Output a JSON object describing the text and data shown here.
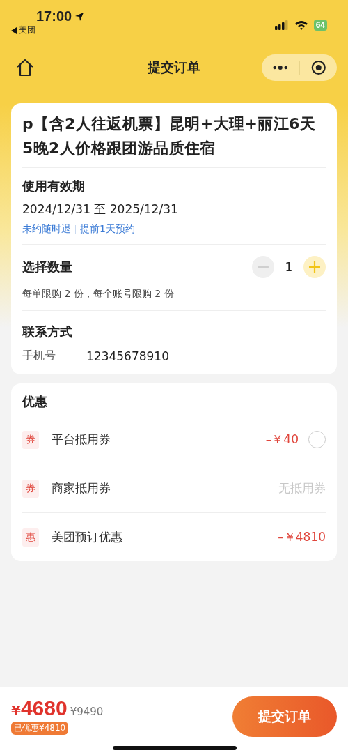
{
  "status_bar": {
    "time": "17:00",
    "back_app": "美团",
    "battery": "64"
  },
  "nav": {
    "title": "提交订单"
  },
  "product": {
    "title": "p【含2人往返机票】昆明+大理+丽江6天5晚2人价格跟团游品质住宿"
  },
  "validity": {
    "label": "使用有效期",
    "dates": "2024/12/31 至 2025/12/31",
    "tags": [
      "未约随时退",
      "提前1天预约"
    ]
  },
  "quantity": {
    "label": "选择数量",
    "value": "1",
    "minus_disabled": true,
    "plus_disabled": false,
    "limit": "每单限购 2 份，每个账号限购 2 份"
  },
  "contact": {
    "label": "联系方式",
    "field_label": "手机号",
    "value": "12345678910"
  },
  "discounts": {
    "title": "优惠",
    "items": [
      {
        "kind": "select",
        "tag": "券",
        "label": "平台抵用券",
        "amount": "–￥40",
        "checked": false
      },
      {
        "kind": "empty",
        "tag": "券",
        "label": "商家抵用券",
        "amount": "无抵用券"
      },
      {
        "kind": "amount",
        "tag": "惠",
        "label": "美团预订优惠",
        "amount": "–￥4810"
      }
    ]
  },
  "footer": {
    "currency": "¥",
    "price": "4680",
    "original_price": "¥9490",
    "saved": "已优惠¥4810",
    "submit": "提交订单"
  }
}
